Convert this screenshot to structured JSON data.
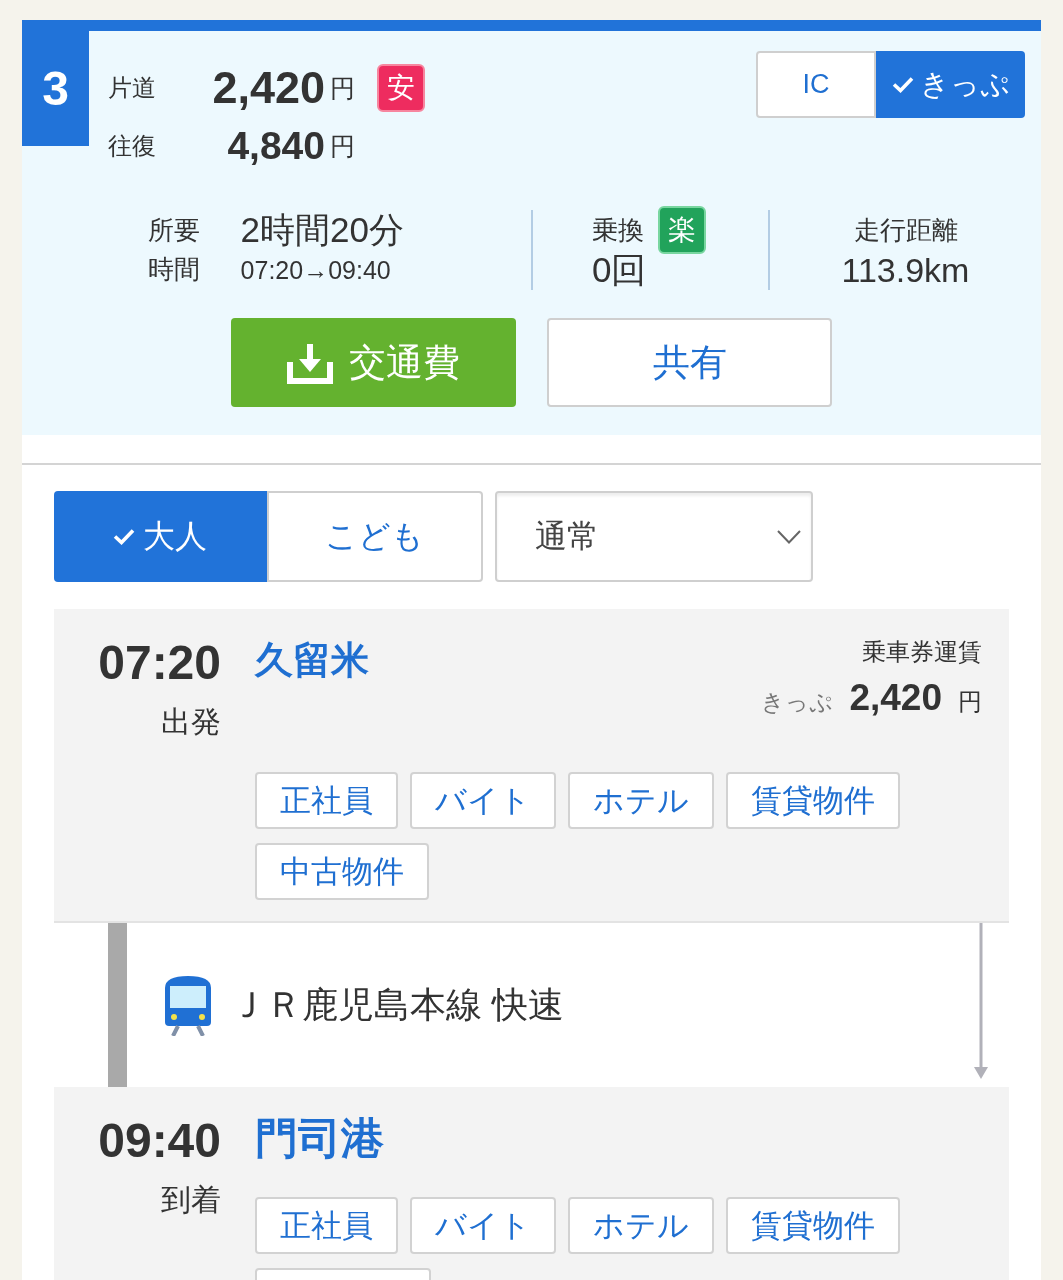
{
  "route": {
    "number": "3",
    "fares": [
      {
        "label": "片道",
        "amount": "2,420",
        "unit": "円",
        "badge": "安"
      },
      {
        "label": "往復",
        "amount": "4,840",
        "unit": "円"
      }
    ],
    "fare_types": [
      {
        "label": "IC",
        "selected": false
      },
      {
        "label": "きっぷ",
        "selected": true
      }
    ]
  },
  "summary": {
    "duration": {
      "label": "所要時間",
      "value": "2時間20分",
      "times": "07:20→09:40"
    },
    "transfers": {
      "label": "乗換",
      "badge": "楽",
      "value": "0回"
    },
    "distance": {
      "label": "走行距離",
      "value": "113.9km"
    }
  },
  "actions": [
    {
      "kind": "download",
      "label": "交通費"
    },
    {
      "kind": "share",
      "label": "共有"
    }
  ],
  "passenger_tabs": [
    {
      "label": "大人",
      "selected": true
    },
    {
      "label": "こども",
      "selected": false
    }
  ],
  "ticket_class_select": {
    "value": "通常"
  },
  "itinerary": [
    {
      "kind": "stop",
      "time": "07:20",
      "event": "出発",
      "station": "久留米",
      "fare": {
        "title": "乗車券運賃",
        "ticket": "きっぷ",
        "amount": "2,420",
        "unit": "円"
      },
      "links": [
        "正社員",
        "バイト",
        "ホテル",
        "賃貸物件",
        "中古物件"
      ]
    },
    {
      "kind": "segment",
      "line": "ＪＲ鹿児島本線 快速"
    },
    {
      "kind": "stop",
      "time": "09:40",
      "event": "到着",
      "station": "門司港",
      "links": [
        "正社員",
        "バイト",
        "ホテル",
        "賃貸物件"
      ],
      "more_links_cut_off": true
    }
  ]
}
